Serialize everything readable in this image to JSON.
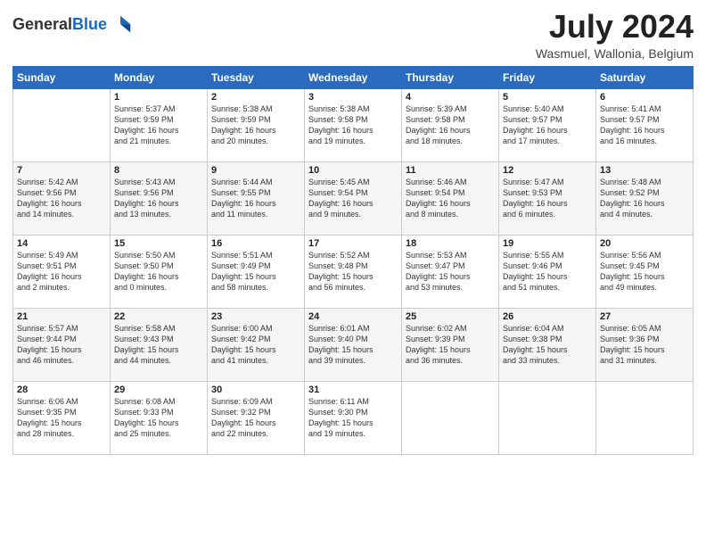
{
  "header": {
    "logo_general": "General",
    "logo_blue": "Blue",
    "month": "July 2024",
    "location": "Wasmuel, Wallonia, Belgium"
  },
  "days_of_week": [
    "Sunday",
    "Monday",
    "Tuesday",
    "Wednesday",
    "Thursday",
    "Friday",
    "Saturday"
  ],
  "weeks": [
    [
      {
        "day": "",
        "info": ""
      },
      {
        "day": "1",
        "info": "Sunrise: 5:37 AM\nSunset: 9:59 PM\nDaylight: 16 hours\nand 21 minutes."
      },
      {
        "day": "2",
        "info": "Sunrise: 5:38 AM\nSunset: 9:59 PM\nDaylight: 16 hours\nand 20 minutes."
      },
      {
        "day": "3",
        "info": "Sunrise: 5:38 AM\nSunset: 9:58 PM\nDaylight: 16 hours\nand 19 minutes."
      },
      {
        "day": "4",
        "info": "Sunrise: 5:39 AM\nSunset: 9:58 PM\nDaylight: 16 hours\nand 18 minutes."
      },
      {
        "day": "5",
        "info": "Sunrise: 5:40 AM\nSunset: 9:57 PM\nDaylight: 16 hours\nand 17 minutes."
      },
      {
        "day": "6",
        "info": "Sunrise: 5:41 AM\nSunset: 9:57 PM\nDaylight: 16 hours\nand 16 minutes."
      }
    ],
    [
      {
        "day": "7",
        "info": "Sunrise: 5:42 AM\nSunset: 9:56 PM\nDaylight: 16 hours\nand 14 minutes."
      },
      {
        "day": "8",
        "info": "Sunrise: 5:43 AM\nSunset: 9:56 PM\nDaylight: 16 hours\nand 13 minutes."
      },
      {
        "day": "9",
        "info": "Sunrise: 5:44 AM\nSunset: 9:55 PM\nDaylight: 16 hours\nand 11 minutes."
      },
      {
        "day": "10",
        "info": "Sunrise: 5:45 AM\nSunset: 9:54 PM\nDaylight: 16 hours\nand 9 minutes."
      },
      {
        "day": "11",
        "info": "Sunrise: 5:46 AM\nSunset: 9:54 PM\nDaylight: 16 hours\nand 8 minutes."
      },
      {
        "day": "12",
        "info": "Sunrise: 5:47 AM\nSunset: 9:53 PM\nDaylight: 16 hours\nand 6 minutes."
      },
      {
        "day": "13",
        "info": "Sunrise: 5:48 AM\nSunset: 9:52 PM\nDaylight: 16 hours\nand 4 minutes."
      }
    ],
    [
      {
        "day": "14",
        "info": "Sunrise: 5:49 AM\nSunset: 9:51 PM\nDaylight: 16 hours\nand 2 minutes."
      },
      {
        "day": "15",
        "info": "Sunrise: 5:50 AM\nSunset: 9:50 PM\nDaylight: 16 hours\nand 0 minutes."
      },
      {
        "day": "16",
        "info": "Sunrise: 5:51 AM\nSunset: 9:49 PM\nDaylight: 15 hours\nand 58 minutes."
      },
      {
        "day": "17",
        "info": "Sunrise: 5:52 AM\nSunset: 9:48 PM\nDaylight: 15 hours\nand 56 minutes."
      },
      {
        "day": "18",
        "info": "Sunrise: 5:53 AM\nSunset: 9:47 PM\nDaylight: 15 hours\nand 53 minutes."
      },
      {
        "day": "19",
        "info": "Sunrise: 5:55 AM\nSunset: 9:46 PM\nDaylight: 15 hours\nand 51 minutes."
      },
      {
        "day": "20",
        "info": "Sunrise: 5:56 AM\nSunset: 9:45 PM\nDaylight: 15 hours\nand 49 minutes."
      }
    ],
    [
      {
        "day": "21",
        "info": "Sunrise: 5:57 AM\nSunset: 9:44 PM\nDaylight: 15 hours\nand 46 minutes."
      },
      {
        "day": "22",
        "info": "Sunrise: 5:58 AM\nSunset: 9:43 PM\nDaylight: 15 hours\nand 44 minutes."
      },
      {
        "day": "23",
        "info": "Sunrise: 6:00 AM\nSunset: 9:42 PM\nDaylight: 15 hours\nand 41 minutes."
      },
      {
        "day": "24",
        "info": "Sunrise: 6:01 AM\nSunset: 9:40 PM\nDaylight: 15 hours\nand 39 minutes."
      },
      {
        "day": "25",
        "info": "Sunrise: 6:02 AM\nSunset: 9:39 PM\nDaylight: 15 hours\nand 36 minutes."
      },
      {
        "day": "26",
        "info": "Sunrise: 6:04 AM\nSunset: 9:38 PM\nDaylight: 15 hours\nand 33 minutes."
      },
      {
        "day": "27",
        "info": "Sunrise: 6:05 AM\nSunset: 9:36 PM\nDaylight: 15 hours\nand 31 minutes."
      }
    ],
    [
      {
        "day": "28",
        "info": "Sunrise: 6:06 AM\nSunset: 9:35 PM\nDaylight: 15 hours\nand 28 minutes."
      },
      {
        "day": "29",
        "info": "Sunrise: 6:08 AM\nSunset: 9:33 PM\nDaylight: 15 hours\nand 25 minutes."
      },
      {
        "day": "30",
        "info": "Sunrise: 6:09 AM\nSunset: 9:32 PM\nDaylight: 15 hours\nand 22 minutes."
      },
      {
        "day": "31",
        "info": "Sunrise: 6:11 AM\nSunset: 9:30 PM\nDaylight: 15 hours\nand 19 minutes."
      },
      {
        "day": "",
        "info": ""
      },
      {
        "day": "",
        "info": ""
      },
      {
        "day": "",
        "info": ""
      }
    ]
  ]
}
